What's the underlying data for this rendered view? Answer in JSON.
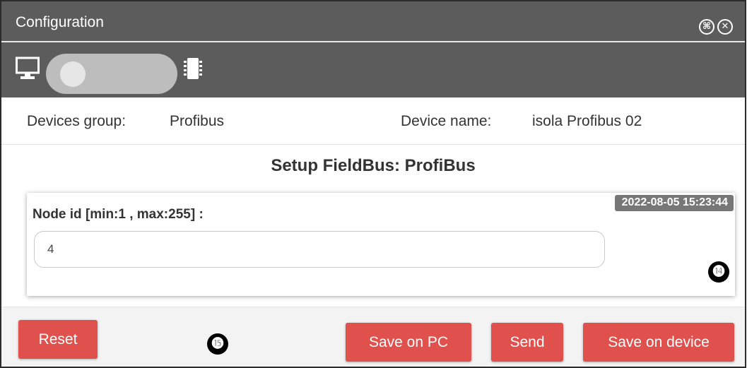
{
  "window": {
    "title": "Configuration",
    "title_icons": [
      "maximize-icon",
      "close-icon"
    ]
  },
  "toolbar": {
    "left_icon": "monitor-icon",
    "right_icon": "chip-icon",
    "toggle_state": "off"
  },
  "info": {
    "group_label": "Devices group:",
    "group_value": "Profibus",
    "device_label": "Device name:",
    "device_value": "isola Profibus 02"
  },
  "main": {
    "heading": "Setup FieldBus: ProfiBus",
    "timestamp": "2022-08-05 15:23:44",
    "node_label": "Node id [min:1 , max:255] :",
    "node_value": "4",
    "badge_panel": "⓮"
  },
  "footer": {
    "reset_label": "Reset",
    "badge": "⓯",
    "save_pc_label": "Save on PC",
    "send_label": "Send",
    "save_device_label": "Save on device"
  },
  "colors": {
    "titlebar": "#5c5c5c",
    "button": "#e0504c",
    "timestamp_bg": "#777777"
  }
}
